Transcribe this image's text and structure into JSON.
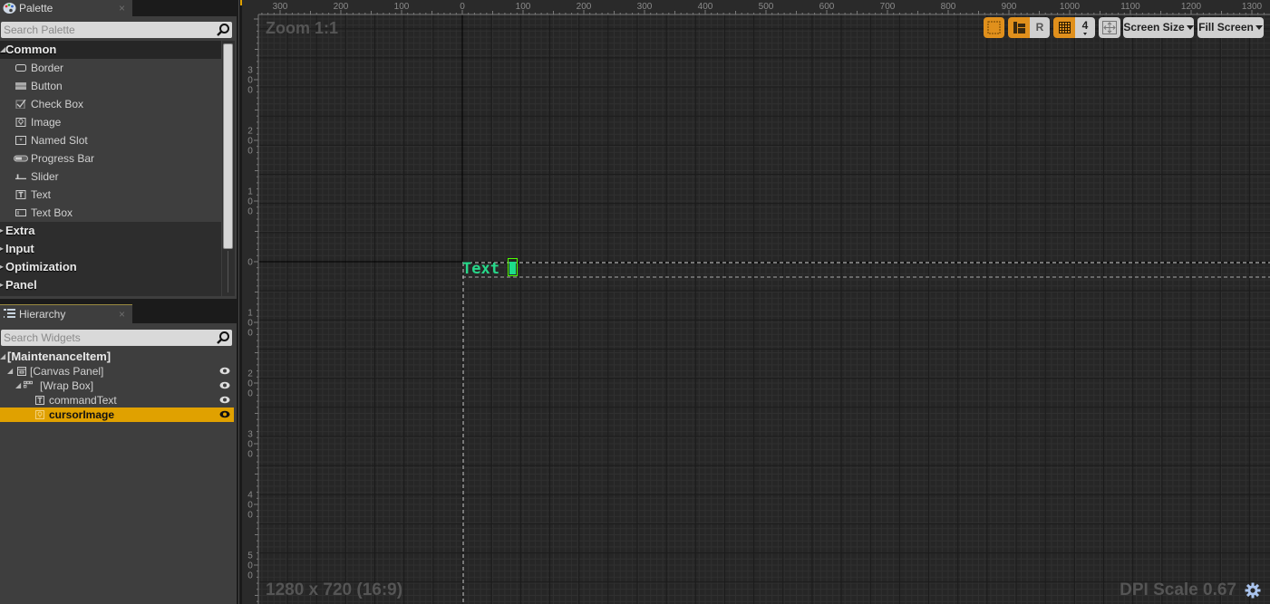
{
  "palette": {
    "tab_label": "Palette",
    "tab_icon": "palette-icon",
    "search_placeholder": "Search Palette",
    "categories": [
      {
        "label": "Common",
        "expanded": true,
        "items": [
          {
            "label": "Border",
            "icon": "border-icon"
          },
          {
            "label": "Button",
            "icon": "button-icon"
          },
          {
            "label": "Check Box",
            "icon": "checkbox-icon"
          },
          {
            "label": "Image",
            "icon": "image-icon"
          },
          {
            "label": "Named Slot",
            "icon": "named-slot-icon"
          },
          {
            "label": "Progress Bar",
            "icon": "progress-bar-icon"
          },
          {
            "label": "Slider",
            "icon": "slider-icon"
          },
          {
            "label": "Text",
            "icon": "text-icon"
          },
          {
            "label": "Text Box",
            "icon": "text-box-icon"
          }
        ]
      },
      {
        "label": "Extra",
        "expanded": false
      },
      {
        "label": "Input",
        "expanded": false
      },
      {
        "label": "Optimization",
        "expanded": false
      },
      {
        "label": "Panel",
        "expanded": false
      }
    ]
  },
  "hierarchy": {
    "tab_label": "Hierarchy",
    "tab_icon": "hierarchy-icon",
    "search_placeholder": "Search Widgets",
    "nodes": [
      {
        "label": "[MaintenanceItem]",
        "depth": 0,
        "root": true
      },
      {
        "label": "[Canvas Panel]",
        "depth": 1,
        "icon": "canvas-panel-icon",
        "visible": true
      },
      {
        "label": "[Wrap Box]",
        "depth": 2,
        "icon": "wrap-box-icon",
        "visible": true
      },
      {
        "label": "commandText",
        "depth": 3,
        "icon": "text-icon",
        "visible": true
      },
      {
        "label": "cursorImage",
        "depth": 3,
        "icon": "image-icon",
        "visible": true,
        "selected": true
      }
    ]
  },
  "designer": {
    "zoom_label": "Zoom 1:1",
    "resolution_label": "1280 x 720 (16:9)",
    "dpi_label": "DPI Scale 0.67",
    "ruler_h_labels": [
      "300",
      "200",
      "100",
      "0",
      "100",
      "200",
      "300",
      "400",
      "500",
      "600",
      "700",
      "800",
      "900",
      "1000",
      "1100",
      "1200",
      "1300"
    ],
    "ruler_h_values": [
      -300,
      -200,
      -100,
      0,
      100,
      200,
      300,
      400,
      500,
      600,
      700,
      800,
      900,
      1000,
      1100,
      1200,
      1300
    ],
    "ruler_v_labels": [
      "300",
      "200",
      "100",
      "0",
      "100",
      "200",
      "300",
      "400",
      "500"
    ],
    "ruler_v_values": [
      -300,
      -200,
      -100,
      0,
      100,
      200,
      300,
      400,
      500
    ],
    "dpi_scale": 0.67,
    "widget_text": "Text",
    "toolbar": {
      "grid_snap_value": "4",
      "respect_locks_label": "R",
      "screen_size_label": "Screen Size",
      "fill_screen_label": "Fill Screen"
    },
    "colors": {
      "accent": "#e0a100",
      "toggle_on": "#e0901c",
      "text_widget": "#27d88a",
      "selection_outline": "#4cff00"
    }
  }
}
